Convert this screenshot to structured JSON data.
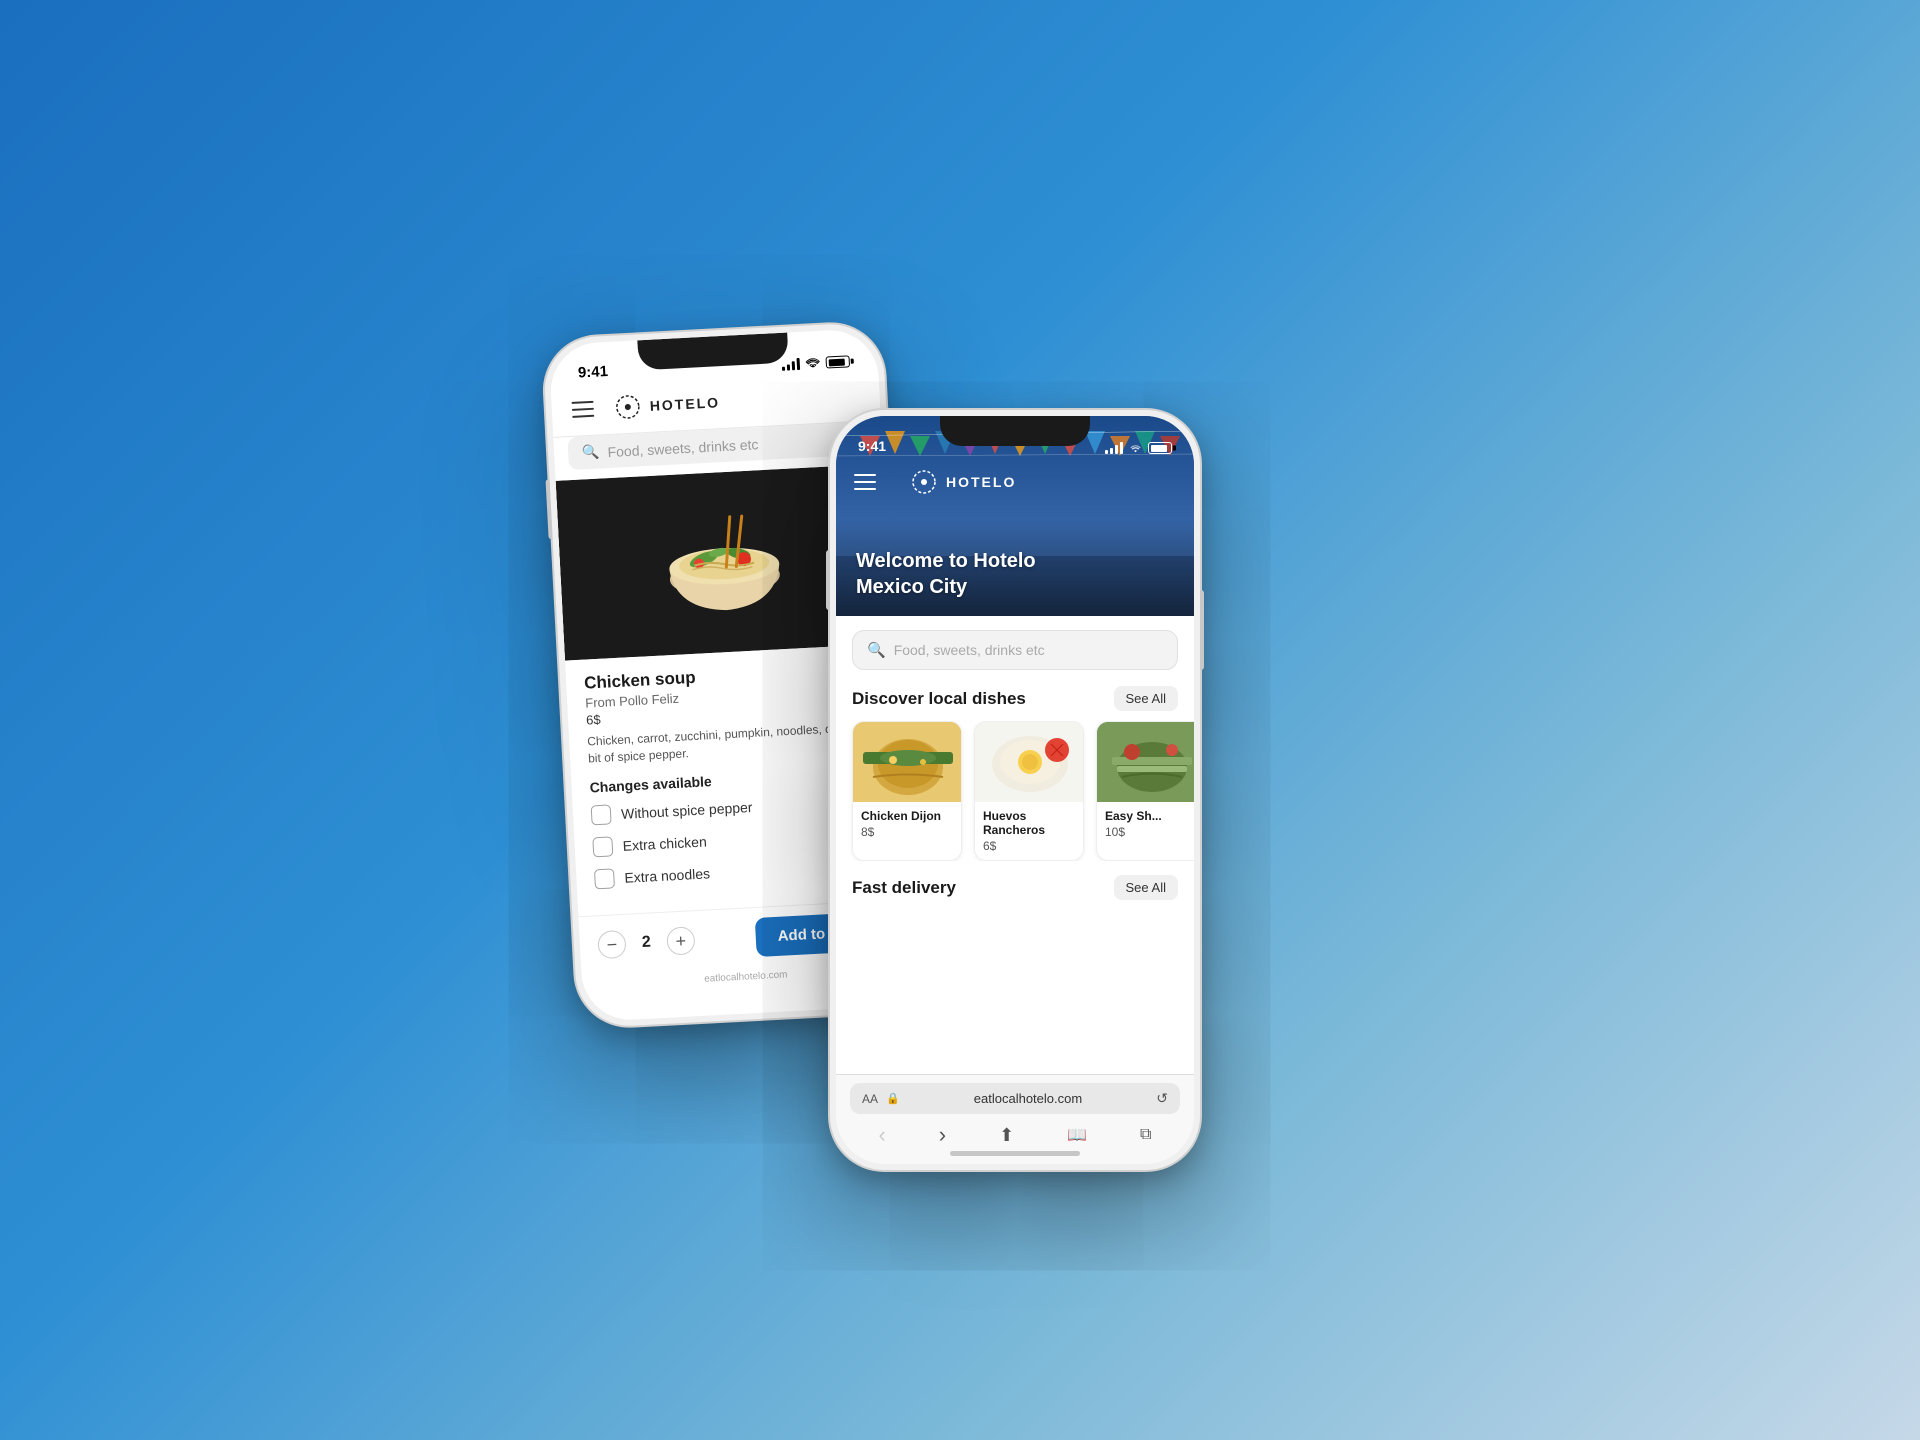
{
  "background": {
    "gradient_start": "#1a6fbe",
    "gradient_end": "#c5d8e8"
  },
  "phone1": {
    "status_time": "9:41",
    "header_logo": "HOTELO",
    "search_placeholder": "Food, sweets, drinks etc",
    "dish_name": "Chicken soup",
    "dish_from": "From Pollo Feliz",
    "dish_price": "6$",
    "dish_description": "Chicken, carrot, zucchini, pumpkin, noodles, o... and a bit of spice pepper.",
    "changes_title": "Changes available",
    "option1": "Without spice pepper",
    "option2": "Extra chicken",
    "option3": "Extra noodles",
    "quantity": "2",
    "add_btn": "Add to order",
    "footer_url": "eatlocalhotelo.com"
  },
  "phone2": {
    "status_time": "9:41",
    "header_logo": "HOTELO",
    "hero_title": "Welcome to Hotelo\nMexico City",
    "search_placeholder": "Food, sweets, drinks etc",
    "discover_title": "Discover local dishes",
    "see_all_1": "See All",
    "dishes": [
      {
        "name": "Chicken Dijon",
        "price": "8$"
      },
      {
        "name": "Huevos Rancheros",
        "price": "6$"
      },
      {
        "name": "Easy Sh...",
        "price": "10$"
      }
    ],
    "fast_delivery_title": "Fast delivery",
    "see_all_2": "See All",
    "url": "eatlocalhotelo.com",
    "footer_url": "eatlocalhotelo.com"
  },
  "icons": {
    "hamburger": "☰",
    "search": "🔍",
    "back": "‹",
    "forward": "›",
    "share": "⬆",
    "bookmark": "📖",
    "tabs": "⧉",
    "lock": "🔒",
    "reload": "↺"
  }
}
